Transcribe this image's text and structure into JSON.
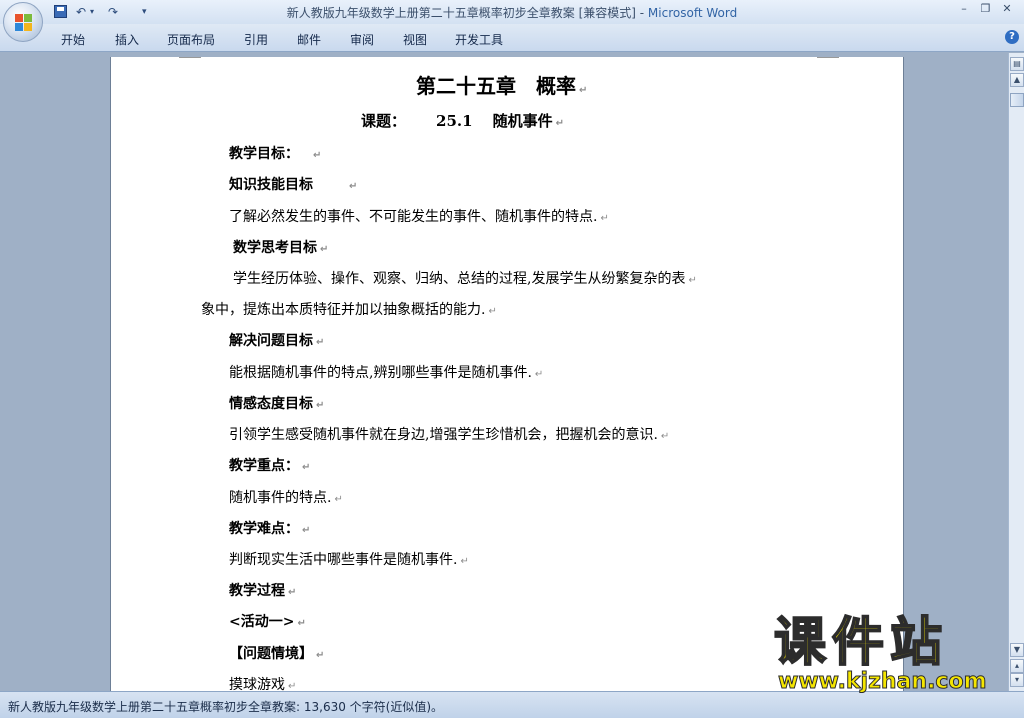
{
  "window": {
    "title_doc": "新人教版九年级数学上册第二十五章概率初步全章教案 [兼容模式] - ",
    "title_app": "Microsoft Word",
    "controls": [
      "–",
      "❐",
      "✕"
    ]
  },
  "quick_access": {
    "undo": "↶",
    "undo_arrow": "▾",
    "redo": "↷",
    "customize": "▾"
  },
  "ribbon": {
    "tabs": [
      "开始",
      "插入",
      "页面布局",
      "引用",
      "邮件",
      "审阅",
      "视图",
      "开发工具"
    ],
    "help": "?"
  },
  "document": {
    "chapter_title": "第二十五章　概率",
    "lesson_label": "课题：",
    "lesson_number": "25.1",
    "lesson_name": "随机事件",
    "mark": "↵",
    "lines": [
      "教学目标：",
      "知识技能目标",
      "了解必然发生的事件、不可能发生的事件、随机事件的特点.",
      "数学思考目标",
      "学生经历体验、操作、观察、归纳、总结的过程,发展学生从纷繁复杂的表",
      "象中，提炼出本质特征并加以抽象概括的能力.",
      "解决问题目标",
      "能根据随机事件的特点,辨别哪些事件是随机事件.",
      "情感态度目标",
      "引领学生感受随机事件就在身边,增强学生珍惜机会，把握机会的意识.",
      "教学重点：",
      "随机事件的特点.",
      "教学难点：",
      "判断现实生活中哪些事件是随机事件.",
      "教学过程",
      "<活动一>",
      "【问题情境】",
      "摸球游戏"
    ]
  },
  "status": {
    "text": "新人教版九年级数学上册第二十五章概率初步全章教案: 13,630 个字符(近似值)。"
  },
  "watermark": {
    "big": "课件站",
    "url": "www.kjzhan.com"
  },
  "colors": {
    "accent": "#3264a5",
    "watermark": "#f5e600",
    "page_bg": "#ffffff",
    "workspace": "#9fb0c6"
  }
}
